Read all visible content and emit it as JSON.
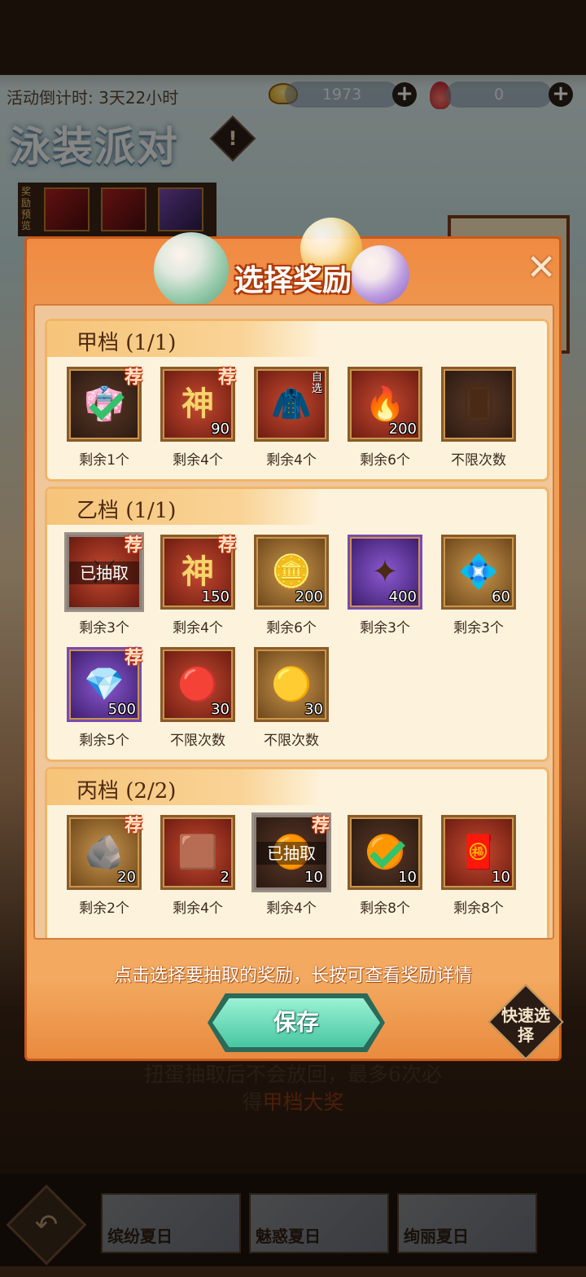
{
  "header": {
    "countdown": "活动倒计时: 3天22小时",
    "gold_amount": "1973",
    "gold_icon": "gold-ingot-icon",
    "token_amount": "0",
    "token_icon": "flame-token-icon",
    "event_title": "泳装派对",
    "info_icon": "!",
    "preview_label": "奖励预览"
  },
  "modal": {
    "title": "选择奖励",
    "close_icon": "✕",
    "hint": "点击选择要抽取的奖励，长按可查看奖励详情",
    "save_label": "保存",
    "quick_select_label": "快速选择",
    "tiers": [
      {
        "title": "甲档 (1/1)",
        "items": [
          {
            "qty": "",
            "remaining": "剩余1个",
            "recommended": "荐",
            "icon": "character-skin-icon",
            "selected": true
          },
          {
            "qty": "90",
            "remaining": "剩余4个",
            "recommended": "荐",
            "icon": "divine-token-icon"
          },
          {
            "qty": "",
            "remaining": "剩余4个",
            "recommended": "",
            "icon": "optional-chest-icon",
            "tag": "自选"
          },
          {
            "qty": "200",
            "remaining": "剩余6个",
            "recommended": "",
            "icon": "fire-orb-icon"
          },
          {
            "qty": "",
            "remaining": "不限次数",
            "recommended": "",
            "icon": "card-pack-icon"
          }
        ]
      },
      {
        "title": "乙档 (1/1)",
        "items": [
          {
            "qty": "",
            "remaining": "剩余3个",
            "recommended": "荐",
            "icon": "warrior-portrait-icon",
            "taken": "已抽取"
          },
          {
            "qty": "150",
            "remaining": "剩余4个",
            "recommended": "荐",
            "icon": "divine-token-icon"
          },
          {
            "qty": "200",
            "remaining": "剩余6个",
            "recommended": "",
            "icon": "gold-coin-icon"
          },
          {
            "qty": "400",
            "remaining": "剩余3个",
            "recommended": "",
            "icon": "purple-star-icon"
          },
          {
            "qty": "60",
            "remaining": "剩余3个",
            "recommended": "",
            "icon": "purple-gem-icon"
          },
          {
            "qty": "500",
            "remaining": "剩余5个",
            "recommended": "荐",
            "icon": "purple-crystal-icon"
          },
          {
            "qty": "30",
            "remaining": "不限次数",
            "recommended": "",
            "icon": "red-stone-icon"
          },
          {
            "qty": "30",
            "remaining": "不限次数",
            "recommended": "",
            "icon": "cloud-coin-icon"
          }
        ]
      },
      {
        "title": "丙档 (2/2)",
        "items": [
          {
            "qty": "20",
            "remaining": "剩余2个",
            "recommended": "荐",
            "icon": "jade-ore-icon"
          },
          {
            "qty": "2",
            "remaining": "剩余4个",
            "recommended": "",
            "icon": "copper-ore-icon"
          },
          {
            "qty": "10",
            "remaining": "剩余4个",
            "recommended": "荐",
            "icon": "amber-orb-icon",
            "taken": "已抽取"
          },
          {
            "qty": "10",
            "remaining": "剩余8个",
            "recommended": "",
            "icon": "amber-orb-icon",
            "selected": true
          },
          {
            "qty": "10",
            "remaining": "剩余8个",
            "recommended": "",
            "icon": "red-envelope-icon"
          }
        ]
      }
    ]
  },
  "footer": {
    "rule_line1": "扭蛋抽取后不会放回，最多6次必",
    "rule_line2_prefix": "得",
    "rule_line2_highlight": "甲档大奖",
    "back_icon": "↶",
    "tabs": [
      "缤纷夏日",
      "魅惑夏日",
      "绚丽夏日"
    ]
  }
}
